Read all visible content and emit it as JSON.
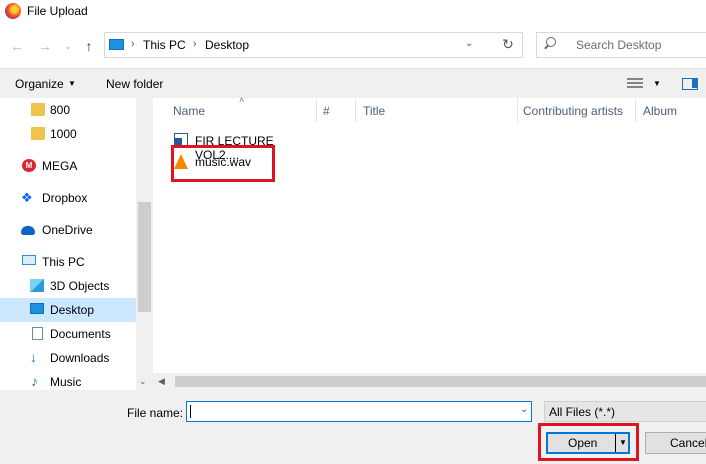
{
  "window": {
    "title": "File Upload"
  },
  "address_bar": {
    "breadcrumbs": [
      "This PC",
      "Desktop"
    ],
    "search_placeholder": "Search Desktop"
  },
  "toolbar": {
    "organize": "Organize",
    "new_folder": "New folder"
  },
  "nav_pane": {
    "items": [
      {
        "label": "800",
        "icon": "folder-icon"
      },
      {
        "label": "1000",
        "icon": "folder-icon"
      },
      {
        "label": "MEGA",
        "icon": "mega-icon"
      },
      {
        "label": "Dropbox",
        "icon": "dropbox-icon"
      },
      {
        "label": "OneDrive",
        "icon": "onedrive-icon"
      },
      {
        "label": "This PC",
        "icon": "computer-icon"
      },
      {
        "label": "3D Objects",
        "icon": "cube-icon"
      },
      {
        "label": "Desktop",
        "icon": "monitor-icon",
        "selected": true
      },
      {
        "label": "Documents",
        "icon": "document-icon"
      },
      {
        "label": "Downloads",
        "icon": "download-icon"
      },
      {
        "label": "Music",
        "icon": "music-icon"
      }
    ]
  },
  "file_list": {
    "columns": [
      "Name",
      "#",
      "Title",
      "Contributing artists",
      "Album"
    ],
    "files": [
      {
        "name": "FIR LECTURE VOL2....",
        "icon": "word-document-icon"
      },
      {
        "name": "music.wav",
        "icon": "vlc-icon"
      }
    ]
  },
  "bottom": {
    "file_name_label": "File name:",
    "file_name_value": "",
    "filter": "All Files (*.*)",
    "open_label": "Open",
    "cancel_label": "Cancel"
  },
  "colors": {
    "highlight": "#e0141e",
    "accent": "#0078d7",
    "selection": "#cce8ff"
  }
}
